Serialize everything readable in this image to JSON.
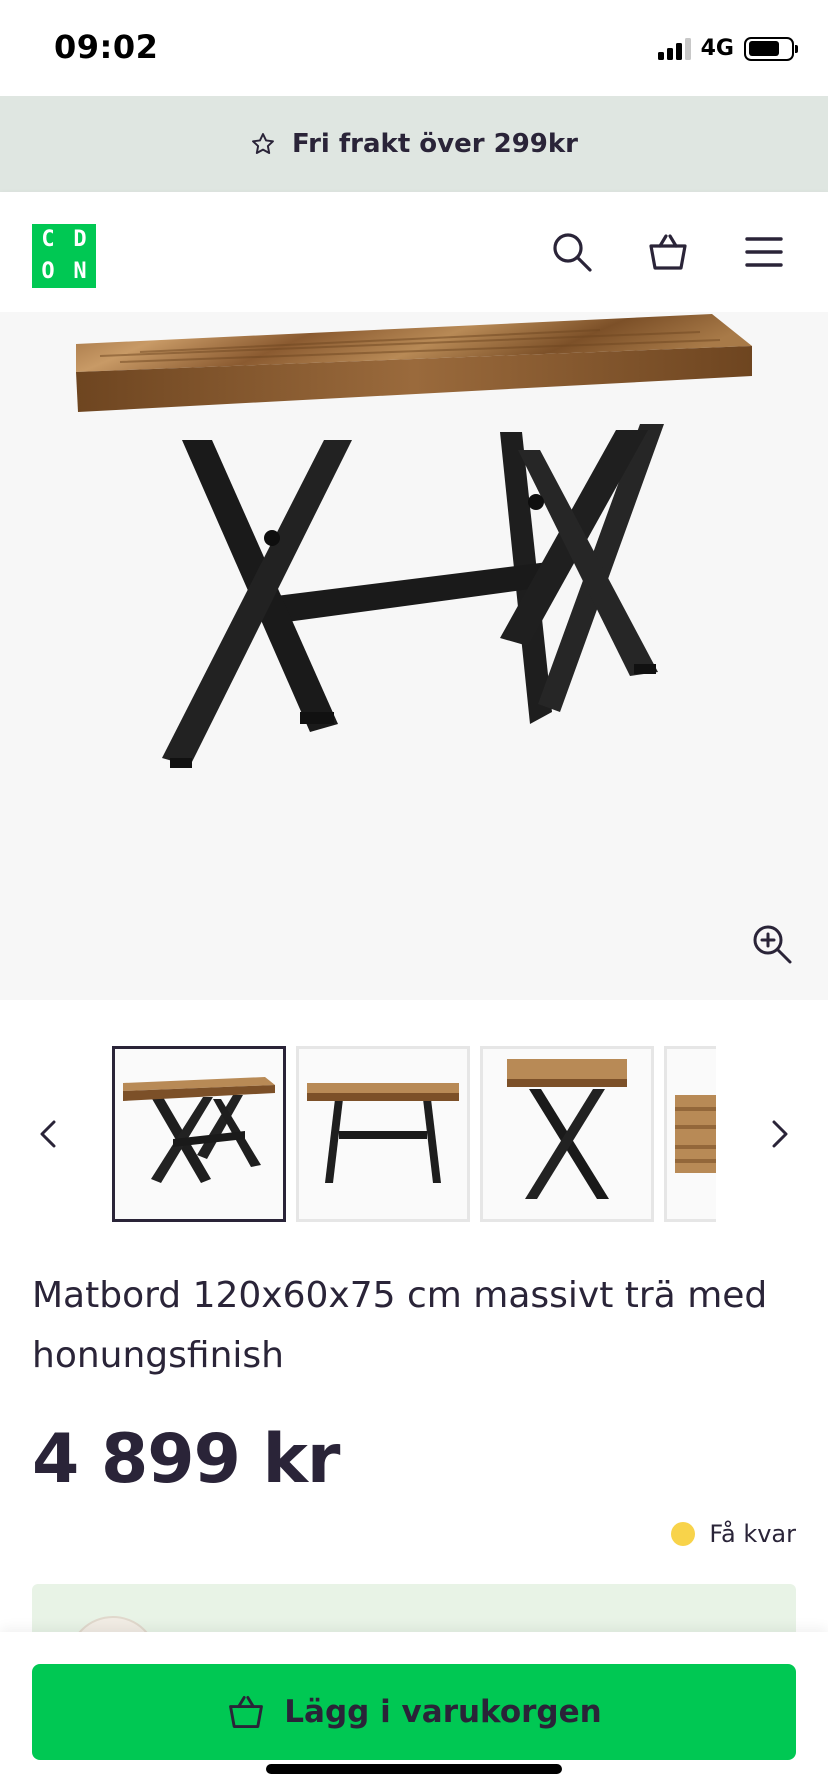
{
  "status_bar": {
    "time": "09:02",
    "network": "4G",
    "signal_bars_filled": 3,
    "battery_level": 0.75
  },
  "banner": {
    "text": "Fri frakt över 299kr",
    "icon": "star-outline-icon",
    "background": "#dfe6e1"
  },
  "header": {
    "logo_letters": [
      "C",
      "D",
      "O",
      "N"
    ],
    "logo_color": "#00c853",
    "icons": [
      "search-icon",
      "basket-icon",
      "menu-icon"
    ]
  },
  "gallery": {
    "zoom_icon": "zoom-in-icon",
    "thumbnails": [
      "table-angled-view",
      "table-front-view",
      "table-side-view",
      "wood-texture-detail"
    ],
    "active_index": 0,
    "prev_icon": "chevron-left-icon",
    "next_icon": "chevron-right-icon"
  },
  "product": {
    "title": "Matbord 120x60x75 cm massivt trä med honungsfinish",
    "price": "4 899 kr",
    "stock_label": "Få kvar",
    "stock_color": "#f8d34a"
  },
  "cta": {
    "label": "Lägg i varukorgen",
    "icon": "basket-icon",
    "color": "#00c853"
  }
}
